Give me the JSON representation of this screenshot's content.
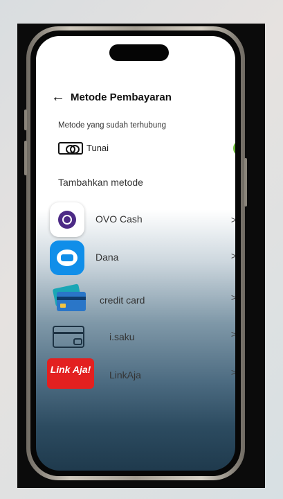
{
  "header": {
    "back_glyph": "←",
    "title": "Metode Pembayaran"
  },
  "connected": {
    "heading": "Metode yang sudah terhubung",
    "item": {
      "label": "Tunai",
      "icon": "cash-icon",
      "status_icon": "check-circle-icon",
      "status_color": "#6dbb3b"
    }
  },
  "add": {
    "heading": "Tambahkan metode",
    "methods": [
      {
        "label": "OVO Cash",
        "icon": "ovo-icon",
        "chevron": ">"
      },
      {
        "label": "Dana",
        "icon": "dana-icon",
        "chevron": ">"
      },
      {
        "label": "credit card",
        "icon": "credit-card-icon",
        "chevron": ">"
      },
      {
        "label": "i.saku",
        "icon": "isaku-icon",
        "chevron": ">"
      },
      {
        "label": "LinkAja",
        "icon": "linkaja-icon",
        "chevron": ">",
        "icon_text": "Link Aja!"
      }
    ]
  },
  "colors": {
    "ovo": "#4c2a86",
    "dana": "#108ee9",
    "linkaja": "#e32020"
  }
}
